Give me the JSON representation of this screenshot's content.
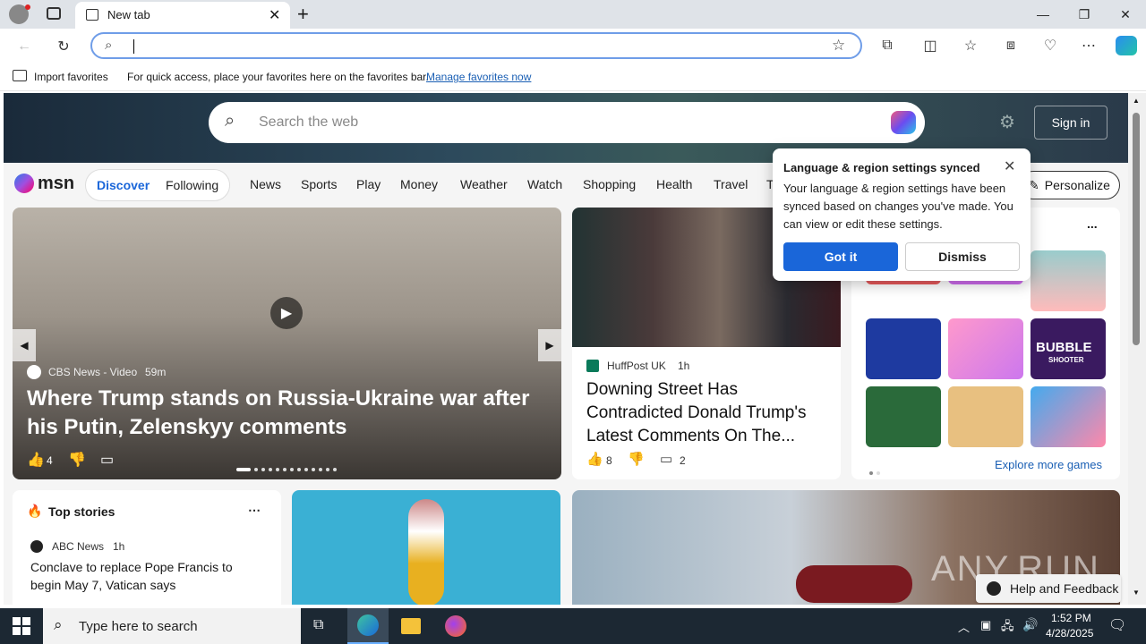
{
  "browser": {
    "tab_title": "New tab",
    "address_value": "",
    "favbar": {
      "import_label": "Import favorites",
      "hint_text": "For quick access, place your favorites here on the favorites bar.",
      "manage_link": "Manage favorites now"
    }
  },
  "msn": {
    "search_placeholder": "Search the web",
    "sign_in": "Sign in",
    "logo": "msn",
    "nav": {
      "discover": "Discover",
      "following": "Following",
      "items": [
        "News",
        "Sports",
        "Play",
        "Money",
        "Weather",
        "Watch",
        "Shopping",
        "Health",
        "Travel",
        "T"
      ],
      "personalize": "Personalize"
    },
    "main_story": {
      "source": "CBS News - Video",
      "age": "59m",
      "headline": "Where Trump stands on Russia-Ukraine war after his Putin, Zelenskyy comments",
      "likes": "4"
    },
    "second_story": {
      "source": "HuffPost UK",
      "age": "1h",
      "headline": "Downing Street Has Contradicted Donald Trump's Latest Comments On The...",
      "likes": "8",
      "comments": "2"
    },
    "games": {
      "more": "...",
      "explore": "Explore more games",
      "bubble_title": "BUBBLE",
      "bubble_sub": "SHOOTER"
    },
    "top_stories": {
      "title": "Top stories",
      "source": "ABC News",
      "age": "1h",
      "headline": "Conclave to replace Pope Francis to begin May 7, Vatican says"
    },
    "feedback": "Help and Feedback"
  },
  "popup": {
    "title": "Language & region settings synced",
    "body": "Your language & region settings have been synced based on changes you've made. You can view or edit these settings.",
    "got_it": "Got it",
    "dismiss": "Dismiss"
  },
  "taskbar": {
    "search_placeholder": "Type here to search",
    "time": "1:52 PM",
    "date": "4/28/2025"
  },
  "watermark": "ANY.RUN"
}
